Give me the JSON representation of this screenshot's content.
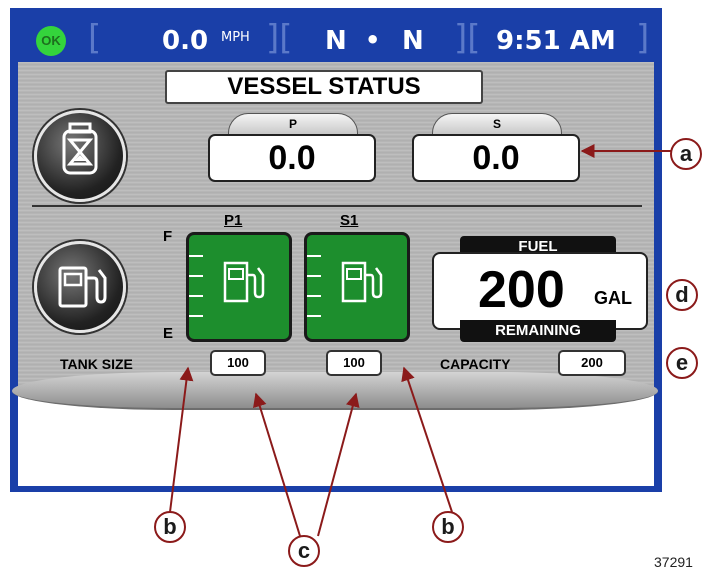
{
  "status": {
    "indicator_label": "OK",
    "indicator_color": "#34d43c"
  },
  "topbar": {
    "speed_value": "0.0",
    "speed_unit": "MPH",
    "gear_port": "N",
    "gear_separator": "•",
    "gear_stbd": "N",
    "time": "9:51 AM"
  },
  "screen": {
    "title": "VESSEL STATUS"
  },
  "engine_hours": {
    "icon": "hourglass-icon",
    "port_label": "P",
    "port_value": "0.0",
    "stbd_label": "S",
    "stbd_value": "0.0"
  },
  "fuel": {
    "icon": "fuel-pump-icon",
    "full_label": "F",
    "empty_label": "E",
    "tanks": [
      {
        "label": "P1",
        "size": "100",
        "icon": "fuel-pump-icon",
        "color": "#1d8e2d"
      },
      {
        "label": "S1",
        "size": "100",
        "icon": "fuel-pump-icon",
        "color": "#1d8e2d"
      }
    ],
    "tank_size_label": "TANK SIZE",
    "fuel_label": "FUEL",
    "remaining_value": "200",
    "remaining_unit": "GAL",
    "remaining_label": "REMAINING",
    "capacity_label": "CAPACITY",
    "capacity_value": "200"
  },
  "callouts": {
    "a": "a",
    "b_left": "b",
    "c": "c",
    "b_right": "b",
    "d": "d",
    "e": "e",
    "color": "#8b1a1a"
  },
  "figure_ref": "37291"
}
